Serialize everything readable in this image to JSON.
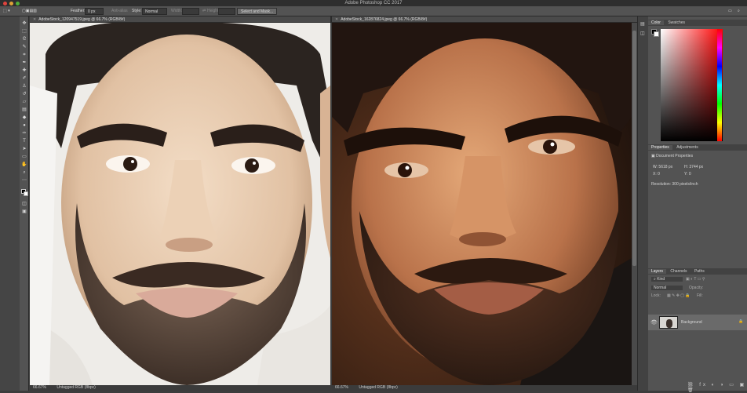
{
  "app": {
    "title": "Adobe Photoshop CC 2017"
  },
  "options_bar": {
    "feather_label": "Feather:",
    "feather_value": "0 px",
    "anti_alias_label": "Anti-alias",
    "style_label": "Style:",
    "style_value": "Normal",
    "width_label": "Width:",
    "height_label": "Height:",
    "select_mask_button": "Select and Mask..."
  },
  "documents": [
    {
      "tab": "AdobeStock_120947519.jpeg @ 66.7% (RGB/8#)",
      "status_zoom": "66.67%",
      "status_profile": "Untagged RGB (8bpc)"
    },
    {
      "tab": "AdobeStock_162876824.jpeg @ 66.7% (RGB/8#)",
      "status_zoom": "66.67%",
      "status_profile": "Untagged RGB (8bpc)"
    }
  ],
  "color_panel": {
    "tabs": [
      "Color",
      "Swatches"
    ]
  },
  "properties_panel": {
    "tabs": [
      "Properties",
      "Adjustments"
    ],
    "section": "Document Properties",
    "w": "W: 5618 px",
    "h": "H: 3744 px",
    "x": "X: 0",
    "y": "Y: 0",
    "resolution": "Resolution: 300 pixels/inch"
  },
  "layers_panel": {
    "tabs": [
      "Layers",
      "Channels",
      "Paths"
    ],
    "filter_placeholder": "Kind",
    "blend_mode": "Normal",
    "opacity_label": "Opacity:",
    "lock_label": "Lock:",
    "fill_label": "Fill:",
    "layer_name": "Background"
  },
  "colors": {
    "accent": "#2d2d2d",
    "panel": "#535353"
  }
}
